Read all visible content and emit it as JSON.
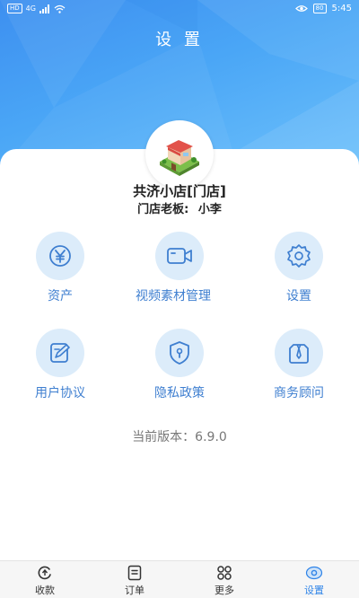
{
  "status_bar": {
    "left_chips": [
      "HD",
      "4G"
    ],
    "battery": "80",
    "time": "5:45"
  },
  "header": {
    "title": "设 置"
  },
  "profile": {
    "store_name": "共济小店[门店]",
    "owner_label": "门店老板:",
    "owner_name": "小李"
  },
  "grid": [
    {
      "label": "资产",
      "icon": "yuan-icon"
    },
    {
      "label": "视频素材管理",
      "icon": "video-icon"
    },
    {
      "label": "设置",
      "icon": "gear-icon"
    },
    {
      "label": "用户协议",
      "icon": "edit-document-icon"
    },
    {
      "label": "隐私政策",
      "icon": "shield-lock-icon"
    },
    {
      "label": "商务顾问",
      "icon": "advisor-tie-icon"
    }
  ],
  "version_text": "当前版本：6.9.0",
  "tabbar": [
    {
      "label": "收款",
      "icon": "receive-payment-icon"
    },
    {
      "label": "订单",
      "icon": "order-list-icon"
    },
    {
      "label": "更多",
      "icon": "more-grid-icon"
    },
    {
      "label": "设置",
      "icon": "settings-tab-icon",
      "active": true
    }
  ],
  "colors": {
    "accent": "#2f84e8",
    "icon_bg": "#dcecfa",
    "label_blue": "#3f7fd0"
  }
}
